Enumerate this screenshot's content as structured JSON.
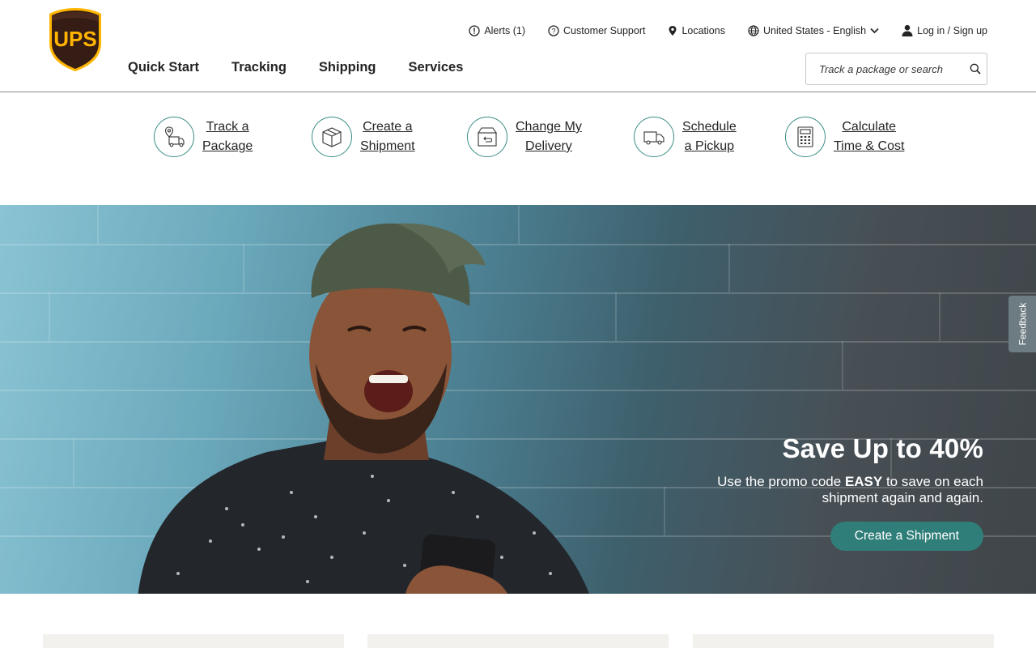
{
  "brand": {
    "logo_text": "UPS"
  },
  "utility_nav": {
    "alerts": "Alerts (1)",
    "support": "Customer Support",
    "locations": "Locations",
    "language": "United States - English",
    "login": "Log in / Sign up"
  },
  "main_nav": {
    "items": [
      "Quick Start",
      "Tracking",
      "Shipping",
      "Services"
    ]
  },
  "search": {
    "placeholder": "Track a package or search"
  },
  "quick_links": [
    {
      "line1": "Track a",
      "line2": "Package",
      "icon": "track-package-icon"
    },
    {
      "line1": "Create a",
      "line2": "Shipment",
      "icon": "box-icon"
    },
    {
      "line1": "Change My",
      "line2": "Delivery",
      "icon": "change-delivery-icon"
    },
    {
      "line1": "Schedule",
      "line2": "a Pickup",
      "icon": "truck-icon"
    },
    {
      "line1": "Calculate",
      "line2": "Time & Cost",
      "icon": "calculator-icon"
    }
  ],
  "hero": {
    "title": "Save Up to 40%",
    "desc_before": "Use the promo code ",
    "promo_code": "EASY",
    "desc_after": " to save on each shipment again and again.",
    "cta": "Create a Shipment"
  },
  "feedback": "Feedback",
  "colors": {
    "accent": "#2f7e79",
    "brand_brown": "#351c15",
    "brand_gold": "#ffb500"
  }
}
